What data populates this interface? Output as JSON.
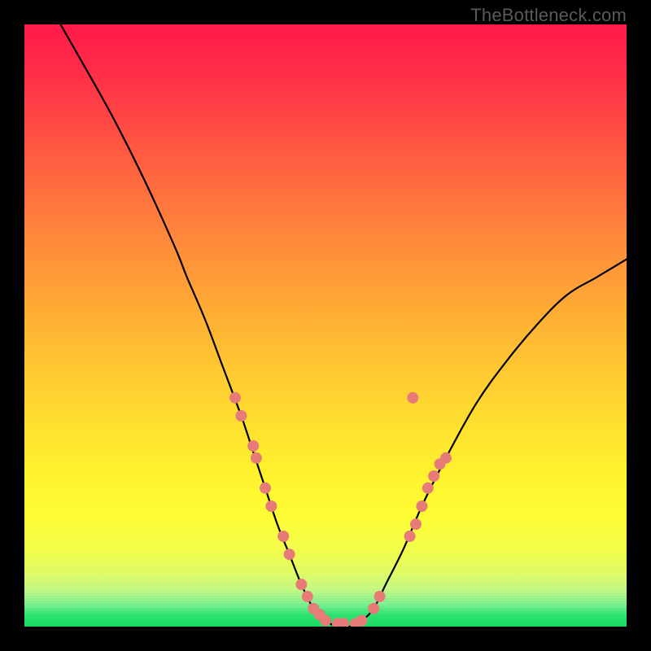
{
  "watermark": {
    "text": "TheBottleneck.com"
  },
  "chart_data": {
    "type": "line",
    "title": "",
    "xlabel": "",
    "ylabel": "",
    "xlim": [
      0,
      100
    ],
    "ylim": [
      0,
      100
    ],
    "grid": false,
    "legend": false,
    "background": {
      "kind": "vertical-gradient",
      "stops": [
        {
          "pos": 0,
          "color": "#ff1a49"
        },
        {
          "pos": 50,
          "color": "#ffab35"
        },
        {
          "pos": 80,
          "color": "#fdfd35"
        },
        {
          "pos": 96,
          "color": "#74ef8f"
        },
        {
          "pos": 100,
          "color": "#17db62"
        }
      ]
    },
    "series": [
      {
        "name": "bottleneck-curve",
        "color": "#000000",
        "x": [
          6,
          10,
          15,
          20,
          25,
          27,
          30,
          33,
          36,
          38,
          40,
          42,
          44,
          46,
          48,
          50,
          52,
          54,
          56,
          58,
          60,
          63,
          66,
          70,
          75,
          80,
          85,
          90,
          95,
          100
        ],
        "y": [
          100,
          93,
          84,
          74,
          63,
          58,
          51,
          43,
          35,
          29,
          23,
          17,
          12,
          7,
          3,
          1,
          0,
          0,
          1,
          3,
          7,
          13,
          20,
          28,
          37,
          44,
          50,
          55,
          58,
          61
        ]
      }
    ],
    "markers": {
      "name": "data-dots",
      "color": "#e77b78",
      "radius_px": 7,
      "points": [
        {
          "x": 35,
          "y": 38
        },
        {
          "x": 36,
          "y": 35
        },
        {
          "x": 38,
          "y": 30
        },
        {
          "x": 38.5,
          "y": 28
        },
        {
          "x": 40,
          "y": 23
        },
        {
          "x": 41,
          "y": 20
        },
        {
          "x": 43,
          "y": 15
        },
        {
          "x": 44,
          "y": 12
        },
        {
          "x": 46,
          "y": 7
        },
        {
          "x": 47,
          "y": 5
        },
        {
          "x": 48,
          "y": 3
        },
        {
          "x": 49,
          "y": 2
        },
        {
          "x": 50,
          "y": 1
        },
        {
          "x": 52,
          "y": 0.5
        },
        {
          "x": 53,
          "y": 0.5
        },
        {
          "x": 55,
          "y": 0.5
        },
        {
          "x": 56,
          "y": 1
        },
        {
          "x": 58,
          "y": 3
        },
        {
          "x": 59,
          "y": 5
        },
        {
          "x": 64,
          "y": 15
        },
        {
          "x": 65,
          "y": 17
        },
        {
          "x": 66,
          "y": 20
        },
        {
          "x": 67,
          "y": 23
        },
        {
          "x": 68,
          "y": 25
        },
        {
          "x": 69,
          "y": 27
        },
        {
          "x": 70,
          "y": 28
        },
        {
          "x": 64.5,
          "y": 38
        }
      ]
    }
  }
}
